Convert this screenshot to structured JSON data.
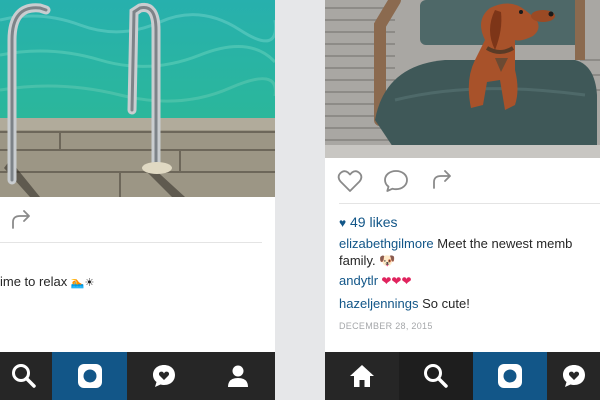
{
  "left_post": {
    "caption_fragment": "ime to relax",
    "emoji": "🏊☀",
    "tabs": [
      "search",
      "camera",
      "activity",
      "profile"
    ],
    "active_tab": "camera"
  },
  "right_post": {
    "likes_label": "49 likes",
    "comments": [
      {
        "user": "elizabethgilmore",
        "text": " Meet the newest memb",
        "line2": "family. 🐶"
      },
      {
        "user": "andytlr",
        "text": " ❤❤❤"
      },
      {
        "user": "hazeljennings",
        "text": " So cute!"
      }
    ],
    "date": "DECEMBER 28, 2015",
    "tabs": [
      "home",
      "search",
      "camera",
      "activity"
    ],
    "active_tab": "camera"
  },
  "colors": {
    "brand_blue": "#125688",
    "tabbar": "#262626",
    "heart": "#e0245e"
  }
}
